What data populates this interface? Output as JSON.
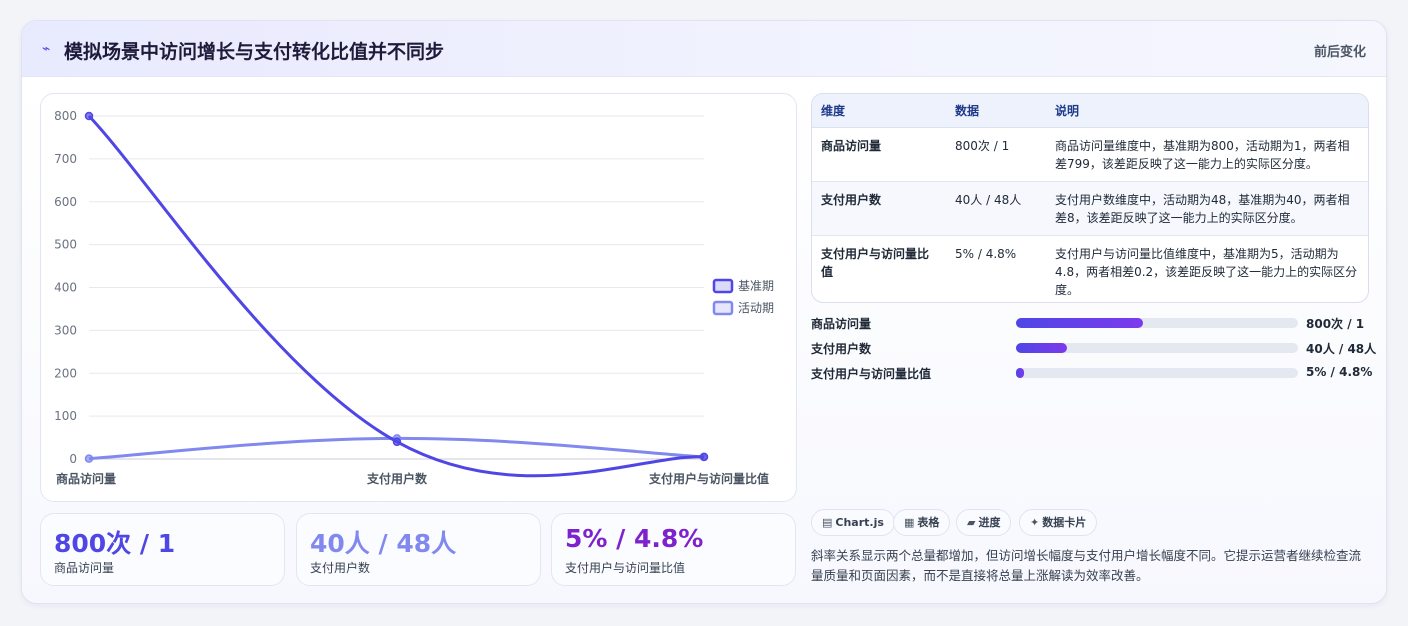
{
  "header": {
    "title": "模拟场景中访问增长与支付转化比值并不同步",
    "badge": "前后变化"
  },
  "chart_data": {
    "type": "line",
    "categories": [
      "商品访问量",
      "支付用户数",
      "支付用户与访问量比值"
    ],
    "series": [
      {
        "name": "基准期",
        "values": [
          800,
          40,
          5
        ],
        "color": "#4f46e5"
      },
      {
        "name": "活动期",
        "values": [
          1,
          48,
          4.8
        ],
        "color": "#8189ef"
      }
    ],
    "ylim": [
      0,
      800
    ],
    "yticks": [
      0,
      100,
      200,
      300,
      400,
      500,
      600,
      700,
      800
    ],
    "grid": true,
    "legend": "right"
  },
  "kpis": [
    {
      "value": "800次 / 1",
      "label": "商品访问量",
      "color": "#4f46e5"
    },
    {
      "value": "40人 / 48人",
      "label": "支付用户数",
      "color": "#8189ef"
    },
    {
      "value": "5% / 4.8%",
      "label": "支付用户与访问量比值",
      "color": "#7e22ce"
    }
  ],
  "table": {
    "headers": [
      "维度",
      "数据",
      "说明"
    ],
    "rows": [
      {
        "dim": "商品访问量",
        "data": "800次 / 1",
        "desc": "商品访问量维度中，基准期为800，活动期为1，两者相差799，该差距反映了这一能力上的实际区分度。"
      },
      {
        "dim": "支付用户数",
        "data": "40人 / 48人",
        "desc": "支付用户数维度中，活动期为48，基准期为40，两者相差8，该差距反映了这一能力上的实际区分度。"
      },
      {
        "dim": "支付用户与访问量比值",
        "data": "5% / 4.8%",
        "desc": "支付用户与访问量比值维度中，基准期为5，活动期为4.8，两者相差0.2，该差距反映了这一能力上的实际区分度。"
      }
    ]
  },
  "progress": [
    {
      "label": "商品访问量",
      "value_text": "800次 / 1",
      "fraction": 0.45
    },
    {
      "label": "支付用户数",
      "value_text": "40人 / 48人",
      "fraction": 0.18
    },
    {
      "label": "支付用户与访问量比值",
      "value_text": "5% / 4.8%",
      "fraction": 0.03
    }
  ],
  "tags": [
    {
      "icon": "▤",
      "label": "Chart.js",
      "icon_name": "chart-icon"
    },
    {
      "icon": "▦",
      "label": "表格",
      "icon_name": "table-icon"
    },
    {
      "icon": "▰",
      "label": "进度",
      "icon_name": "progress-icon"
    },
    {
      "icon": "✦",
      "label": "数据卡片",
      "icon_name": "sparkle-icon"
    }
  ],
  "note": "斜率关系显示两个总量都增加，但访问增长幅度与支付用户增长幅度不同。它提示运营者继续检查流量质量和页面因素，而不是直接将总量上涨解读为效率改善。"
}
